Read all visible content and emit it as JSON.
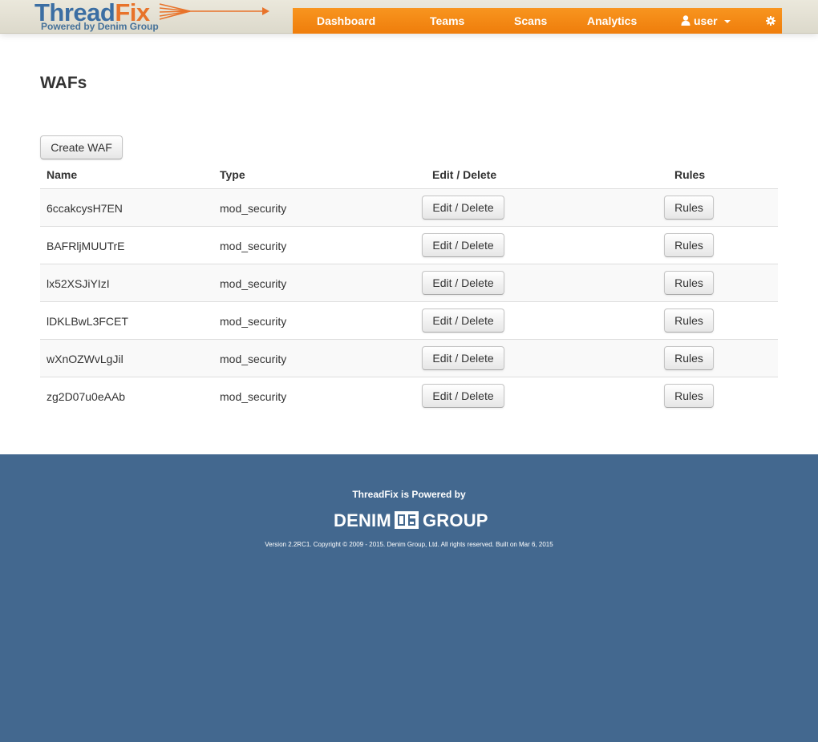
{
  "logo": {
    "word_part1": "Thread",
    "word_part2": "Fix",
    "tagline": "Powered by Denim Group"
  },
  "nav": {
    "items": [
      {
        "label": "Dashboard"
      },
      {
        "label": "Teams"
      },
      {
        "label": "Scans"
      },
      {
        "label": "Analytics"
      }
    ],
    "user_label": "user"
  },
  "page": {
    "title": "WAFs",
    "create_button": "Create WAF"
  },
  "table": {
    "headers": [
      "Name",
      "Type",
      "Edit / Delete",
      "Rules"
    ],
    "rows": [
      {
        "name": "6ccakcysH7EN",
        "type": "mod_security",
        "edit": "Edit / Delete",
        "rules": "Rules"
      },
      {
        "name": "BAFRljMUUTrE",
        "type": "mod_security",
        "edit": "Edit / Delete",
        "rules": "Rules"
      },
      {
        "name": "lx52XSJiYIzI",
        "type": "mod_security",
        "edit": "Edit / Delete",
        "rules": "Rules"
      },
      {
        "name": "lDKLBwL3FCET",
        "type": "mod_security",
        "edit": "Edit / Delete",
        "rules": "Rules"
      },
      {
        "name": "wXnOZWvLgJil",
        "type": "mod_security",
        "edit": "Edit / Delete",
        "rules": "Rules"
      },
      {
        "name": "zg2D07u0eAAb",
        "type": "mod_security",
        "edit": "Edit / Delete",
        "rules": "Rules"
      }
    ]
  },
  "footer": {
    "powered_by": "ThreadFix is Powered by",
    "denim_word1": "DENIM",
    "denim_word2": "GROUP",
    "copyright": "Version 2.2RC1. Copyright © 2009 - 2015. Denim Group, Ltd. All rights reserved. Built on Mar 6, 2015"
  },
  "colors": {
    "nav_orange": "#f28a13",
    "logo_blue": "#3b6ea3",
    "logo_orange": "#e8732a",
    "footer_blue": "#43688f"
  },
  "icons": {
    "user": "user-icon",
    "caret": "caret-down-icon",
    "settings": "gear-icon"
  }
}
